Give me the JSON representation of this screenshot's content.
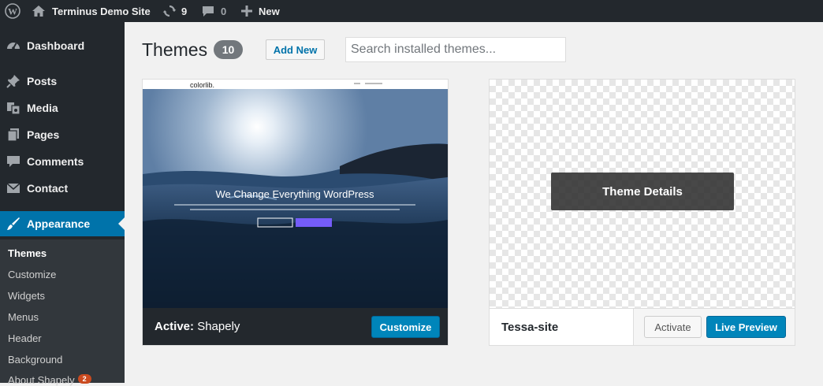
{
  "adminbar": {
    "site_name": "Terminus Demo Site",
    "updates_count": "9",
    "comments_count": "0",
    "new_label": "New"
  },
  "sidebar": {
    "items": [
      {
        "label": "Dashboard",
        "icon": "dashboard-icon"
      },
      {
        "label": "Posts",
        "icon": "pin-icon"
      },
      {
        "label": "Media",
        "icon": "media-icon"
      },
      {
        "label": "Pages",
        "icon": "pages-icon"
      },
      {
        "label": "Comments",
        "icon": "comments-icon"
      },
      {
        "label": "Contact",
        "icon": "mail-icon"
      },
      {
        "label": "Appearance",
        "icon": "paintbrush-icon"
      }
    ],
    "submenu": [
      {
        "label": "Themes"
      },
      {
        "label": "Customize"
      },
      {
        "label": "Widgets"
      },
      {
        "label": "Menus"
      },
      {
        "label": "Header"
      },
      {
        "label": "Background"
      },
      {
        "label": "About Shapely",
        "badge": "2"
      }
    ]
  },
  "header": {
    "title": "Themes",
    "count": "10",
    "add_new_label": "Add New",
    "search_placeholder": "Search installed themes..."
  },
  "themes": {
    "active": {
      "prefix": "Active:",
      "name": "Shapely",
      "customize_label": "Customize",
      "preview_logo": "colorlib.",
      "preview_headline": "We Change Everything WordPress"
    },
    "tessa": {
      "name": "Tessa-site",
      "details_label": "Theme Details",
      "activate_label": "Activate",
      "live_preview_label": "Live Preview"
    }
  },
  "colors": {
    "admin_dark": "#23282d",
    "accent_blue": "#0073aa",
    "button_blue": "#0085ba"
  }
}
